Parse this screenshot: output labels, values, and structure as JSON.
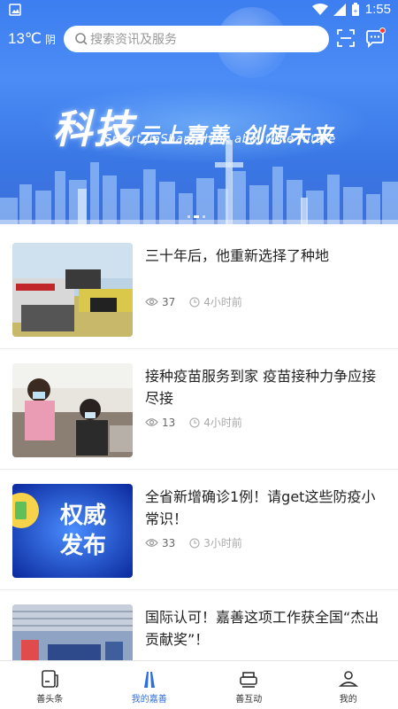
{
  "status_bar": {
    "time": "1:55"
  },
  "header": {
    "temperature": "13℃",
    "condition": "阴",
    "search_placeholder": "搜索资讯及服务"
  },
  "banner": {
    "headline_big": "科技",
    "headline_part1": "云上嘉善",
    "headline_part2": "创想未来",
    "subtitle": "Smart JiaShan, think about the future"
  },
  "feed": [
    {
      "title": "三十年后，他重新选择了种地",
      "views": "37",
      "time": "4小时前",
      "thumb": "harvester-photo"
    },
    {
      "title": "接种疫苗服务到家 疫苗接种力争应接尽接",
      "views": "13",
      "time": "4小时前",
      "thumb": "vaccination-photo"
    },
    {
      "title": "全省新增确诊1例！请get这些防疫小常识！",
      "views": "33",
      "time": "3小时前",
      "thumb": "authority-release-graphic",
      "thumb_text": "权威发布"
    },
    {
      "title": "国际认可！嘉善这项工作获全国“杰出贡献奖”！",
      "views": "",
      "time": "",
      "thumb": "hall-photo"
    }
  ],
  "bottom_nav": [
    {
      "label": "善头条",
      "icon": "news-icon"
    },
    {
      "label": "我的嘉善",
      "icon": "jiashan-icon"
    },
    {
      "label": "善互动",
      "icon": "interact-icon"
    },
    {
      "label": "我的",
      "icon": "profile-icon"
    }
  ],
  "colors": {
    "accent": "#2e6fe0",
    "banner": "#3d7ef0"
  }
}
